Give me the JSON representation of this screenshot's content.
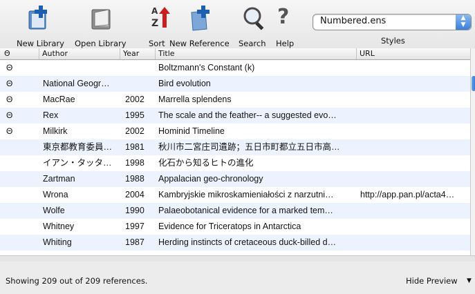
{
  "toolbar": {
    "new_library": "New Library",
    "open_library": "Open Library",
    "sort": "Sort",
    "new_reference": "New Reference",
    "search": "Search",
    "help": "Help",
    "styles_value": "Numbered.ens",
    "styles_label": "Styles"
  },
  "columns": {
    "author": "Author",
    "year": "Year",
    "title": "Title",
    "url": "URL"
  },
  "rows": [
    {
      "clip": "Θ",
      "author": "",
      "year": "",
      "title": "Boltzmann's Constant (k)",
      "url": ""
    },
    {
      "clip": "Θ",
      "author": "National Geogr…",
      "year": "",
      "title": "Bird evolution",
      "url": ""
    },
    {
      "clip": "Θ",
      "author": "MacRae",
      "year": "2002",
      "title": "Marrella splendens",
      "url": ""
    },
    {
      "clip": "Θ",
      "author": "Rex",
      "year": "1995",
      "title": "The scale and the feather-- a suggested evo…",
      "url": ""
    },
    {
      "clip": "Θ",
      "author": "Milkirk",
      "year": "2002",
      "title": "Hominid Timeline",
      "url": ""
    },
    {
      "clip": "",
      "author": "東京都教育委員…",
      "year": "1981",
      "title": "秋川市二宮庄司遺跡；五日市町都立五日市高…",
      "url": ""
    },
    {
      "clip": "",
      "author": "イアン・タッタ…",
      "year": "1998",
      "title": "化石から知るヒトの進化",
      "url": ""
    },
    {
      "clip": "",
      "author": "Zartman",
      "year": "1988",
      "title": "Appalacian geo-chronology",
      "url": ""
    },
    {
      "clip": "",
      "author": "Wrona",
      "year": "2004",
      "title": "Kambryjskie mikroskamieniałości z narzutni…",
      "url": "http://app.pan.pl/acta4…"
    },
    {
      "clip": "",
      "author": "Wolfe",
      "year": "1990",
      "title": "Palaeobotanical evidence for a marked tem…",
      "url": ""
    },
    {
      "clip": "",
      "author": "Whitney",
      "year": "1997",
      "title": "Evidence for Triceratops in Antarctica",
      "url": ""
    },
    {
      "clip": "",
      "author": "Whiting",
      "year": "1987",
      "title": "Herding instincts of cretaceous duck-billed d…",
      "url": ""
    }
  ],
  "status": {
    "text": "Showing 209 out of 209 references.",
    "hide_preview": "Hide Preview"
  }
}
